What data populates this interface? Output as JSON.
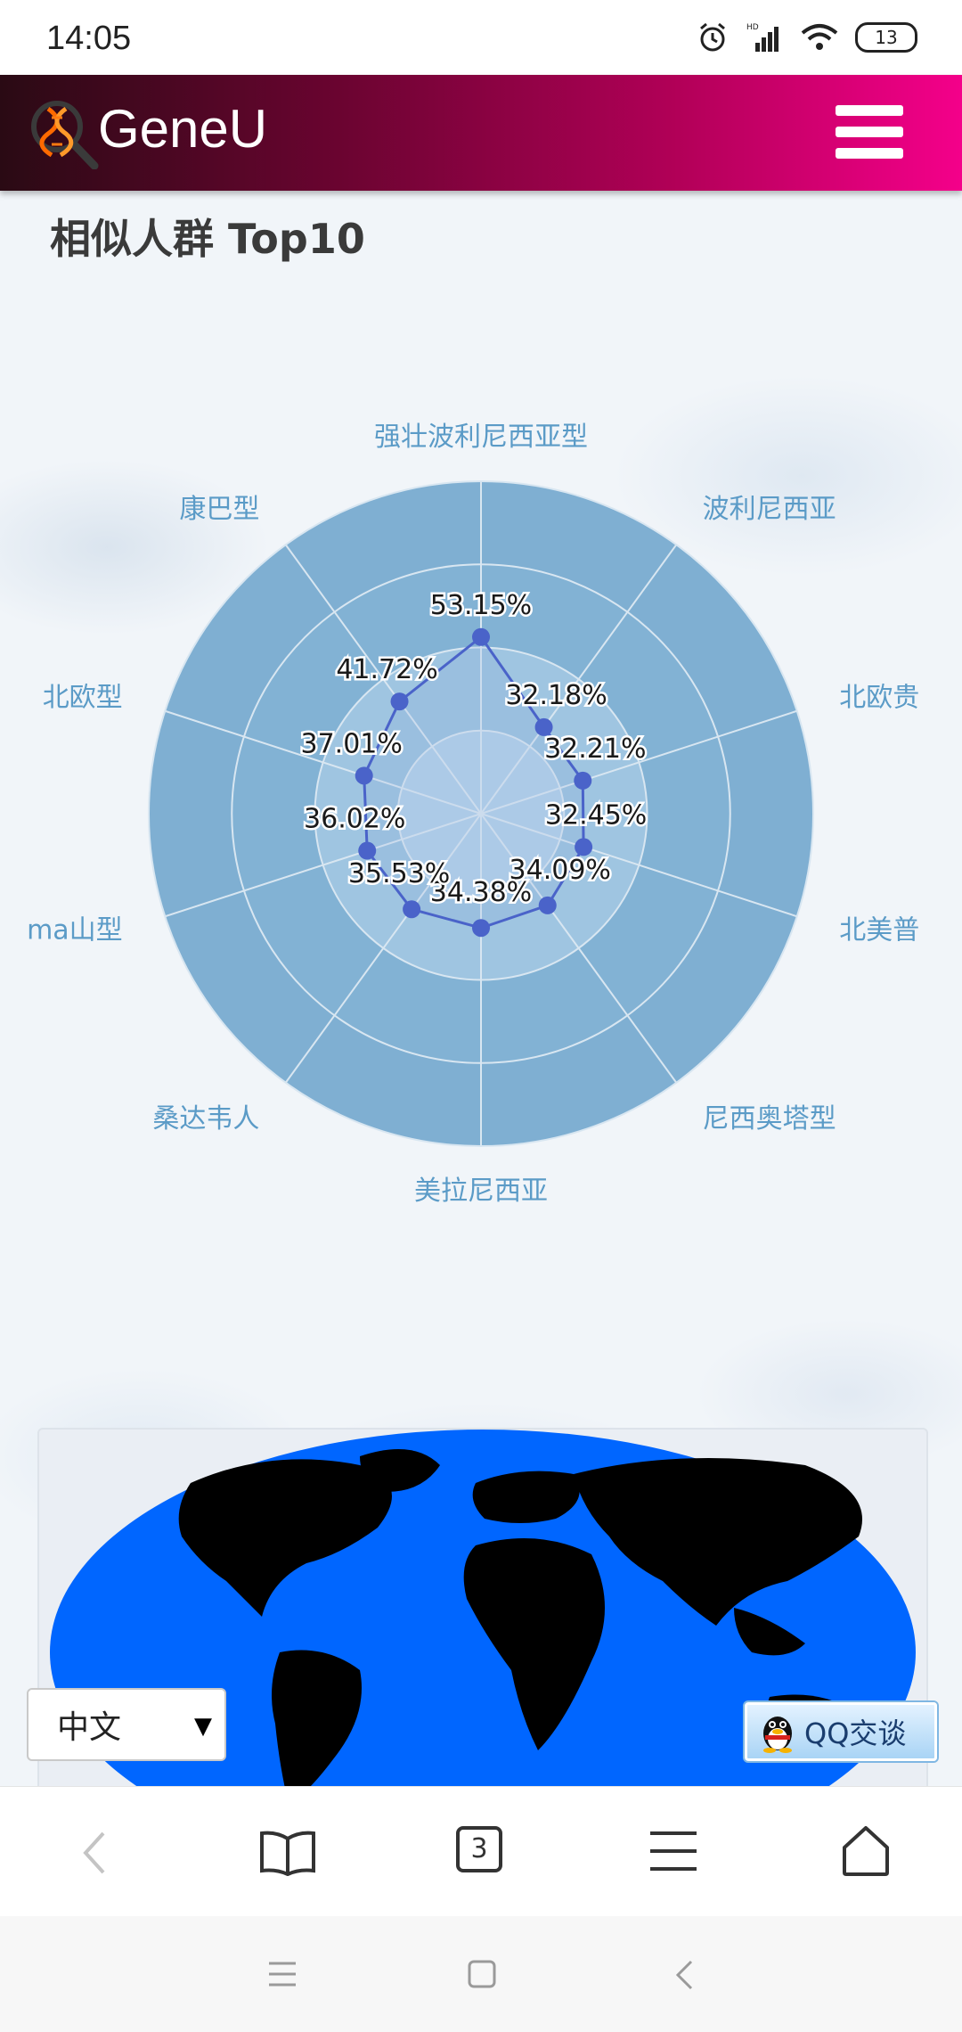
{
  "status_bar": {
    "time": "14:05",
    "battery": "13",
    "network_badge": "HD"
  },
  "header": {
    "app_title": "GeneU",
    "brand_gradient": [
      "#2a0a14",
      "#f4008a"
    ]
  },
  "section": {
    "title": "相似人群 Top10"
  },
  "chart_data": {
    "type": "radar",
    "categories": [
      "强壮波利尼西亚型",
      "波利尼西亚",
      "北欧贵族",
      "北美普通",
      "尼西奥塔型",
      "美拉尼西亚",
      "桑达韦人",
      "Mayima山型",
      "北欧型",
      "康巴型"
    ],
    "category_labels": [
      "强壮波利尼西亚型",
      "波利尼西亚",
      "北欧贵",
      "北美普",
      "尼西奥塔型",
      "美拉尼西亚",
      "桑达韦人",
      "ma山型",
      "北欧型",
      "康巴型"
    ],
    "series": [
      {
        "values": [
          53.15,
          32.18,
          32.21,
          32.45,
          34.09,
          34.38,
          35.53,
          36.02,
          37.01,
          41.72
        ]
      }
    ],
    "value_labels": [
      "53.15%",
      "32.18%",
      "32.21%",
      "32.45%",
      "34.09%",
      "34.38%",
      "35.53%",
      "36.02%",
      "37.01%",
      "41.72%"
    ],
    "range": [
      0,
      100
    ],
    "rings": 4,
    "colors": {
      "line": "#4a63c9",
      "area": "#7eaed1",
      "label": "#5b9bc7"
    }
  },
  "map": {
    "colors": {
      "ocean": "#0066ff",
      "land": "#000000"
    }
  },
  "language_select": {
    "selected": "中文"
  },
  "qq_chat": {
    "label": "QQ交谈"
  },
  "browser_toolbar": {
    "tab_count": "3",
    "icons": [
      "back-icon",
      "bookmarks-icon",
      "tabs-icon",
      "menu-icon",
      "home-icon"
    ]
  },
  "system_nav": {
    "icons": [
      "recents-icon",
      "home-icon",
      "back-icon"
    ]
  }
}
